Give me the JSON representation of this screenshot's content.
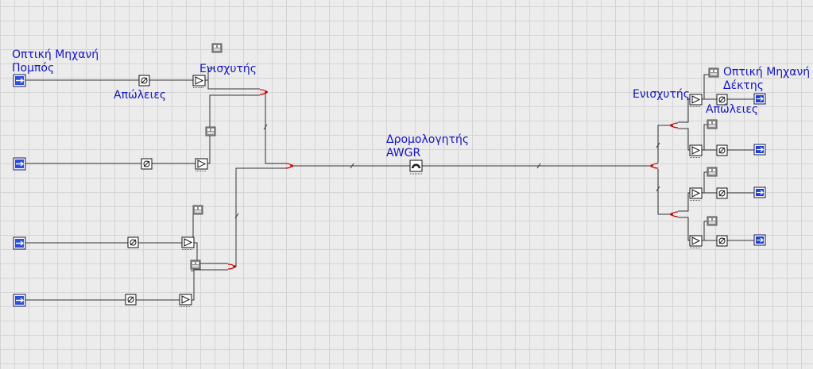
{
  "labels": {
    "tx_title_line1": "Οπτική Μηχανή",
    "tx_title_line2": "Πομπός",
    "losses_left": "Απώλειες",
    "amplifier_left": "Ενισχυτής",
    "router_line1": "Δρομολογητής",
    "router_line2": "AWGR",
    "amplifier_right": "Ενισχυτής",
    "rx_title_line1": "Οπτική Μηχανή",
    "rx_title_line2": "Δέκτης",
    "losses_right": "Απώλειες"
  },
  "colors": {
    "label_text": "#1414c8",
    "wire": "#333333",
    "connector": "#cc0000",
    "grid_line": "#d4d4d4",
    "background": "#ececec"
  },
  "components": {
    "transmitters": 4,
    "receivers": 4,
    "attenuators": 8,
    "amplifiers": 8,
    "meters": 8,
    "couplers": 6,
    "router": 1
  },
  "icons": {
    "transmitter": "optical-transmitter-icon",
    "receiver": "optical-receiver-icon",
    "attenuator": "attenuator-icon",
    "amplifier": "amplifier-icon",
    "meter": "power-meter-icon",
    "coupler": "coupler-icon",
    "router": "awgr-router-icon"
  }
}
